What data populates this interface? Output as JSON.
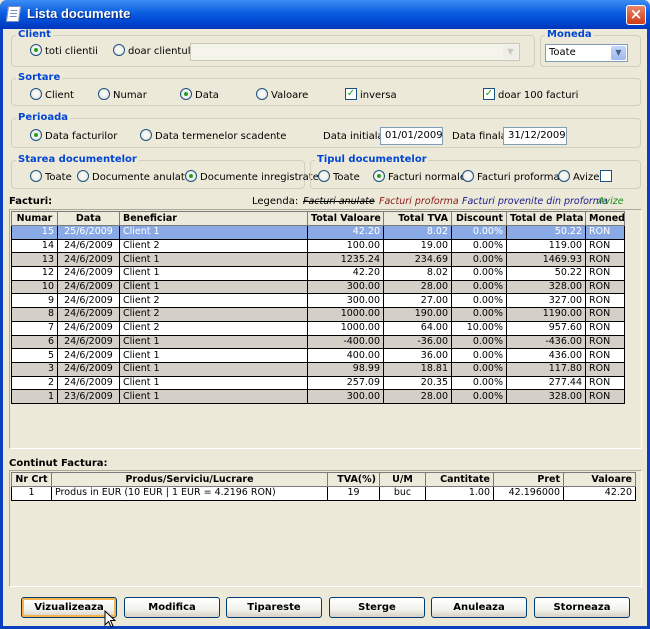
{
  "window": {
    "title": "Lista documente"
  },
  "client": {
    "title": "Client",
    "options": [
      "toti clientii",
      "doar clientul:"
    ],
    "selected": 0,
    "combo_value": ""
  },
  "moneda": {
    "title": "Moneda",
    "value": "Toate"
  },
  "sortare": {
    "title": "Sortare",
    "options": [
      "Client",
      "Numar",
      "Data",
      "Valoare"
    ],
    "selected": 2,
    "inversa": "inversa",
    "doar100": "doar 100 facturi"
  },
  "perioada": {
    "title": "Perioada",
    "options": [
      "Data facturilor",
      "Data termenelor scadente"
    ],
    "selected": 0,
    "start_label": "Data initiala:",
    "start_value": "01/01/2009",
    "end_label": "Data finala:",
    "end_value": "31/12/2009"
  },
  "starea": {
    "title": "Starea documentelor",
    "options": [
      "Toate",
      "Documente anulate",
      "Documente inregistrate"
    ],
    "selected": 2
  },
  "tipul": {
    "title": "Tipul documentelor",
    "options": [
      "Toate",
      "Facturi normale",
      "Facturi proforma",
      "Avize"
    ],
    "selected": 1
  },
  "facturi": {
    "label": "Facturi:",
    "legend_label": "Legenda:",
    "legend": [
      "Facturi anulate",
      "Facturi proforma",
      "Facturi provenite din proforma",
      "Avize"
    ],
    "legend_colors": [
      "#000000",
      "#8B1A1A",
      "#1A1A8B",
      "#1A8B1A"
    ],
    "columns": [
      "Numar",
      "Data",
      "Beneficiar",
      "Total Valoare",
      "Total TVA",
      "Discount",
      "Total de Plata",
      "Moneda"
    ],
    "rows": [
      [
        "15",
        "25/6/2009",
        "Client 1",
        "42.20",
        "8.02",
        "0.00%",
        "50.22",
        "RON"
      ],
      [
        "14",
        "24/6/2009",
        "Client 2",
        "100.00",
        "19.00",
        "0.00%",
        "119.00",
        "RON"
      ],
      [
        "13",
        "24/6/2009",
        "Client 1",
        "1235.24",
        "234.69",
        "0.00%",
        "1469.93",
        "RON"
      ],
      [
        "12",
        "24/6/2009",
        "Client 1",
        "42.20",
        "8.02",
        "0.00%",
        "50.22",
        "RON"
      ],
      [
        "10",
        "24/6/2009",
        "Client 1",
        "300.00",
        "28.00",
        "0.00%",
        "328.00",
        "RON"
      ],
      [
        "9",
        "24/6/2009",
        "Client 2",
        "300.00",
        "27.00",
        "0.00%",
        "327.00",
        "RON"
      ],
      [
        "8",
        "24/6/2009",
        "Client 2",
        "1000.00",
        "190.00",
        "0.00%",
        "1190.00",
        "RON"
      ],
      [
        "7",
        "24/6/2009",
        "Client 2",
        "1000.00",
        "64.00",
        "10.00%",
        "957.60",
        "RON"
      ],
      [
        "6",
        "24/6/2009",
        "Client 1",
        "-400.00",
        "-36.00",
        "0.00%",
        "-436.00",
        "RON"
      ],
      [
        "5",
        "24/6/2009",
        "Client 1",
        "400.00",
        "36.00",
        "0.00%",
        "436.00",
        "RON"
      ],
      [
        "3",
        "24/6/2009",
        "Client 1",
        "98.99",
        "18.81",
        "0.00%",
        "117.80",
        "RON"
      ],
      [
        "2",
        "24/6/2009",
        "Client 1",
        "257.09",
        "20.35",
        "0.00%",
        "277.44",
        "RON"
      ],
      [
        "1",
        "23/6/2009",
        "Client 1",
        "300.00",
        "28.00",
        "0.00%",
        "328.00",
        "RON"
      ]
    ]
  },
  "continut": {
    "label": "Continut Factura:",
    "columns": [
      "Nr Crt",
      "Produs/Serviciu/Lucrare",
      "TVA(%)",
      "U/M",
      "Cantitate",
      "Pret",
      "Valoare"
    ],
    "rows": [
      [
        "1",
        "Produs in EUR (10 EUR | 1 EUR = 4.2196 RON)",
        "19",
        "buc",
        "1.00",
        "42.196000",
        "42.20"
      ]
    ]
  },
  "buttons": [
    "Vizualizeaza",
    "Modifica",
    "Tipareste",
    "Sterge",
    "Anuleaza",
    "Storneaza"
  ],
  "icons": {
    "window": "document-icon",
    "close": "close-icon",
    "cursor": "mouse-pointer-icon"
  }
}
